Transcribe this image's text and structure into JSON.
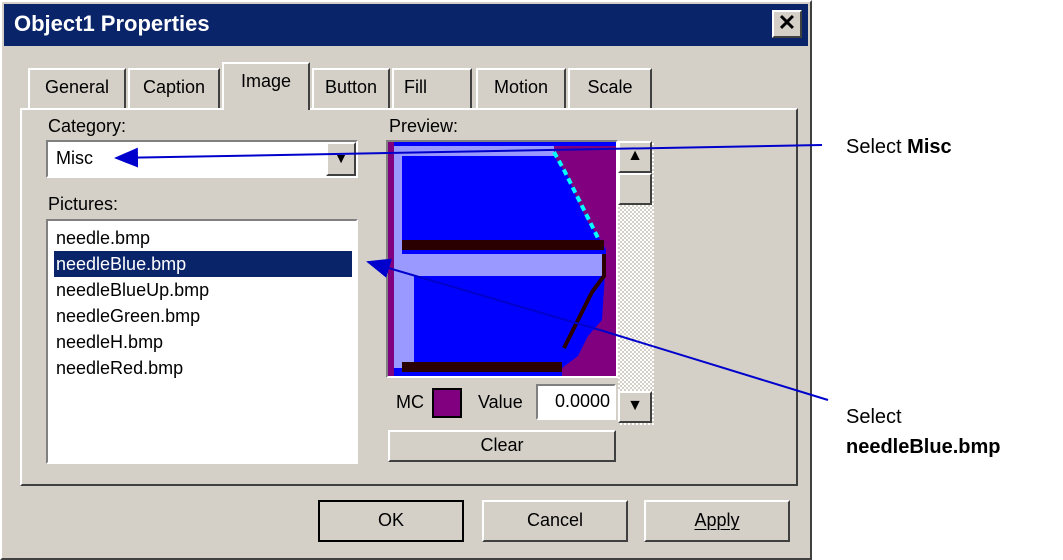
{
  "window": {
    "title": "Object1 Properties",
    "close_glyph": "✕"
  },
  "tabs": [
    "General",
    "Caption",
    "Image",
    "Button",
    "Fill",
    "Motion",
    "Scale"
  ],
  "active_tab": "Image",
  "category": {
    "label": "Category:",
    "value": "Misc"
  },
  "pictures": {
    "label": "Pictures:",
    "items": [
      "needle.bmp",
      "needleBlue.bmp",
      "needleBlueUp.bmp",
      "needleGreen.bmp",
      "needleH.bmp",
      "needleRed.bmp"
    ],
    "selected": "needleBlue.bmp"
  },
  "preview": {
    "label": "Preview:",
    "mc_label": "MC",
    "mc_color": "#800080",
    "value_label": "Value",
    "value": "0.0000",
    "clear_label": "Clear"
  },
  "buttons": {
    "ok": "OK",
    "cancel": "Cancel",
    "apply": "Apply"
  },
  "callouts": {
    "misc_prefix": "Select ",
    "misc_bold": "Misc",
    "needle_prefix": "Select",
    "needle_bold": "needleBlue.bmp"
  },
  "colors": {
    "title_bar": "#0a246a",
    "arrow": "#0000cc",
    "dialog_bg": "#d4d0c8",
    "preview_blue": "#0000ff",
    "preview_purple": "#800080"
  }
}
